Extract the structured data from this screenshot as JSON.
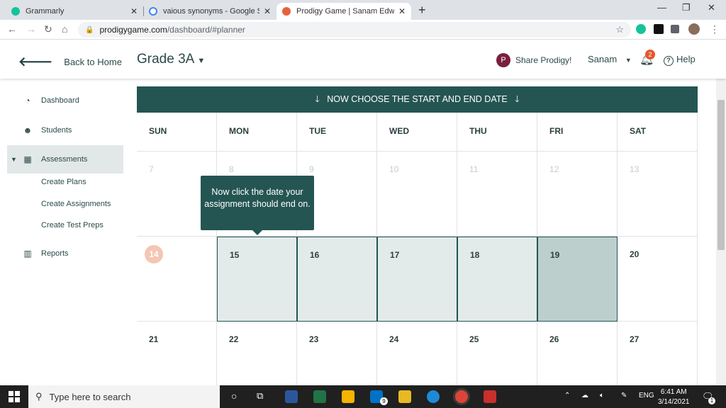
{
  "browser": {
    "tabs": [
      {
        "title": "Grammarly",
        "color": "#15c39a"
      },
      {
        "title": "vaious synonyms - Google Search",
        "color": "#4285f4"
      },
      {
        "title": "Prodigy Game | Sanam Edwards",
        "color": "#e8613c"
      }
    ],
    "new_tab": "+",
    "url_host": "prodigygame.com",
    "url_path": "/dashboard/#planner"
  },
  "header": {
    "back_label": "Back to Home",
    "grade": "Grade 3A",
    "share": "Share Prodigy!",
    "user": "Sanam",
    "notification_count": "2",
    "help": "Help"
  },
  "sidebar": {
    "items": [
      "Dashboard",
      "Students",
      "Assessments",
      "Reports"
    ],
    "subitems": [
      "Create Plans",
      "Create Assignments",
      "Create Test Preps"
    ]
  },
  "planner": {
    "banner": "NOW CHOOSE THE START AND END DATE",
    "days": [
      "SUN",
      "MON",
      "TUE",
      "WED",
      "THU",
      "FRI",
      "SAT"
    ],
    "weeks": [
      [
        "7",
        "8",
        "9",
        "10",
        "11",
        "12",
        "13"
      ],
      [
        "14",
        "15",
        "16",
        "17",
        "18",
        "19",
        "20"
      ],
      [
        "21",
        "22",
        "23",
        "24",
        "25",
        "26",
        "27"
      ]
    ],
    "today": "14",
    "tooltip": "Now click the date your assignment should end on."
  },
  "taskbar": {
    "search_placeholder": "Type here to search",
    "mail_badge": "9",
    "language": "ENG",
    "time": "6:41 AM",
    "date": "3/14/2021",
    "notification_badge": "1"
  },
  "colors": {
    "accent": "#245552",
    "range": "#e3eaea",
    "end": "#bccfcd",
    "today": "#f4c6b3"
  }
}
